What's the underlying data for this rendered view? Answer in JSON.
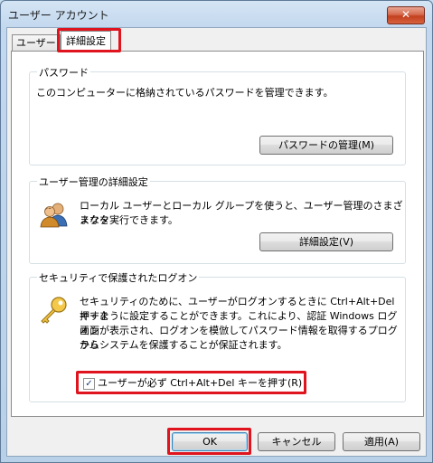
{
  "window": {
    "title": "ユーザー アカウント",
    "close_glyph": "✕"
  },
  "tabs": [
    {
      "label": "ユーザー"
    },
    {
      "label": "詳細設定"
    }
  ],
  "password_group": {
    "title": "パスワード",
    "description": "このコンピューターに格納されているパスワードを管理できます。",
    "button": "パスワードの管理(M)"
  },
  "user_mgmt_group": {
    "title": "ユーザー管理の詳細設定",
    "description_line1": "ローカル ユーザーとローカル グループを使うと、ユーザー管理のさまざまなタ",
    "description_line2": "スクを実行できます。",
    "button": "詳細設定(V)",
    "icon": "users-icon"
  },
  "secure_logon_group": {
    "title": "セキュリティで保護されたログオン",
    "description_lines": [
      "セキュリティのために、ユーザーがログオンするときに Ctrl+Alt+Del キーを",
      "押すように設定することができます。これにより、認証 Windows ログオン",
      "画面が表示され、ログオンを模倣してパスワード情報を取得するプログラム",
      "からシステムを保護することが保証されます。"
    ],
    "checkbox_label": "ユーザーが必ず Ctrl+Alt+Del キーを押す(R)",
    "checkbox_checked": true,
    "check_glyph": "✓",
    "icon": "key-icon"
  },
  "footer": {
    "ok": "OK",
    "cancel": "キャンセル",
    "apply": "適用(A)"
  },
  "colors": {
    "highlight": "#e0141e",
    "accent": "#3c7fb1"
  }
}
